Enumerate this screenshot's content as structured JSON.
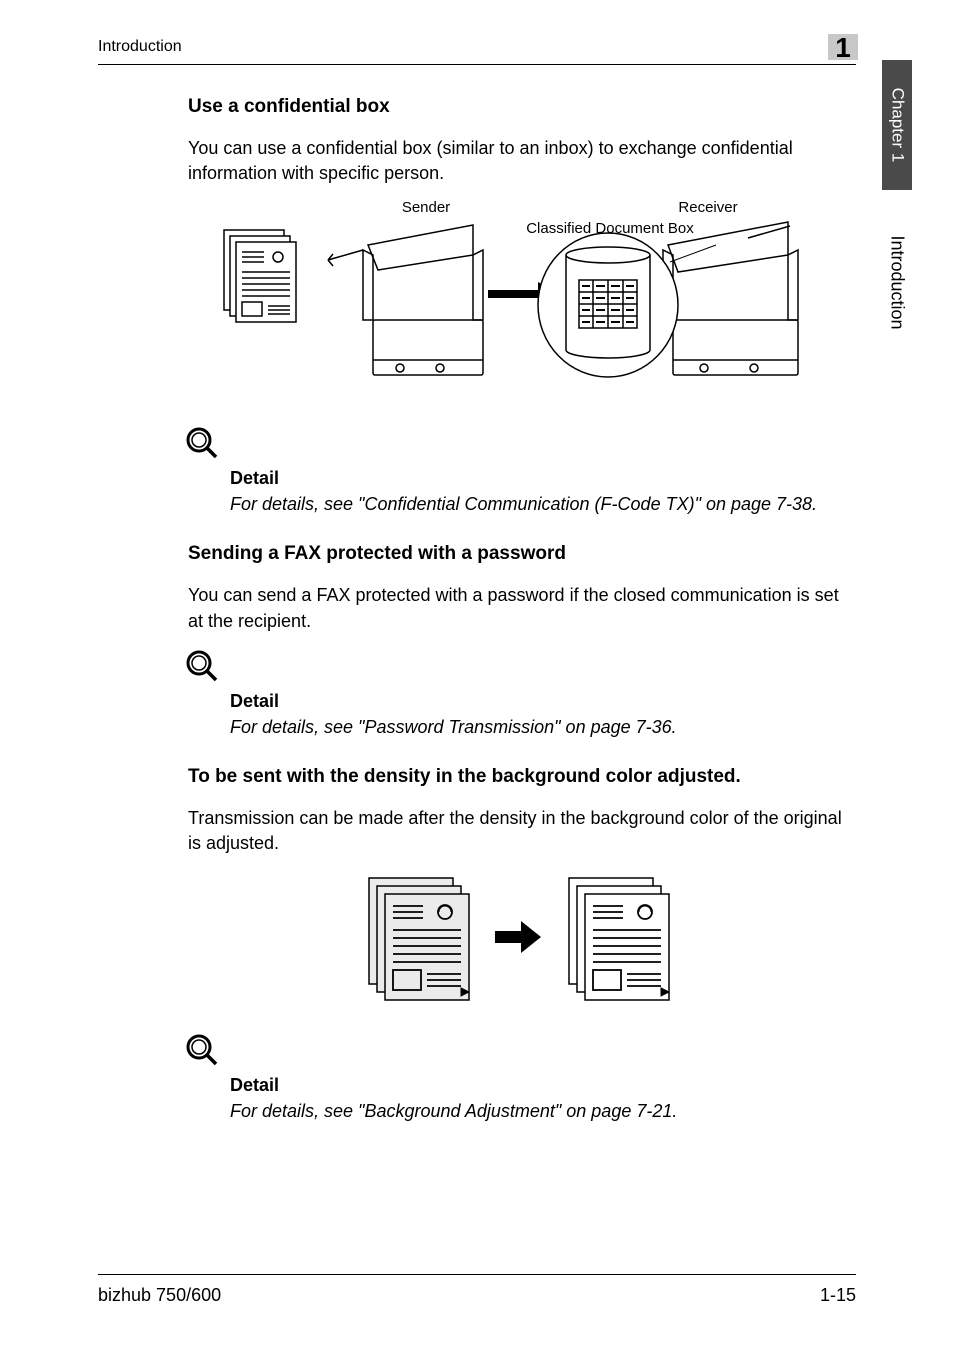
{
  "header": {
    "title": "Introduction"
  },
  "chapter": {
    "num": "1",
    "tab_dark": "Chapter 1",
    "tab_light": "Introduction"
  },
  "sec1": {
    "h": "Use a confidential box",
    "p": "You can use a confidential box (similar to an inbox) to exchange confidential information with specific person.",
    "diag": {
      "sender": "Sender",
      "receiver": "Receiver",
      "boxlabel": "Classified Document Box"
    },
    "detail_label": "Detail",
    "detail_text": "For details, see \"Confidential Communication (F-Code TX)\" on page 7-38."
  },
  "sec2": {
    "h": "Sending a FAX protected with a password",
    "p": "You can send a FAX protected with a password if the closed communication is set at the recipient.",
    "detail_label": "Detail",
    "detail_text": "For details, see \"Password Transmission\" on page 7-36."
  },
  "sec3": {
    "h": "To be sent with the density in the background color adjusted.",
    "p": "Transmission can be made after the density in the background color of the original is adjusted.",
    "detail_label": "Detail",
    "detail_text": "For details, see \"Background Adjustment\" on page 7-21."
  },
  "footer": {
    "model": "bizhub 750/600",
    "page": "1-15"
  }
}
